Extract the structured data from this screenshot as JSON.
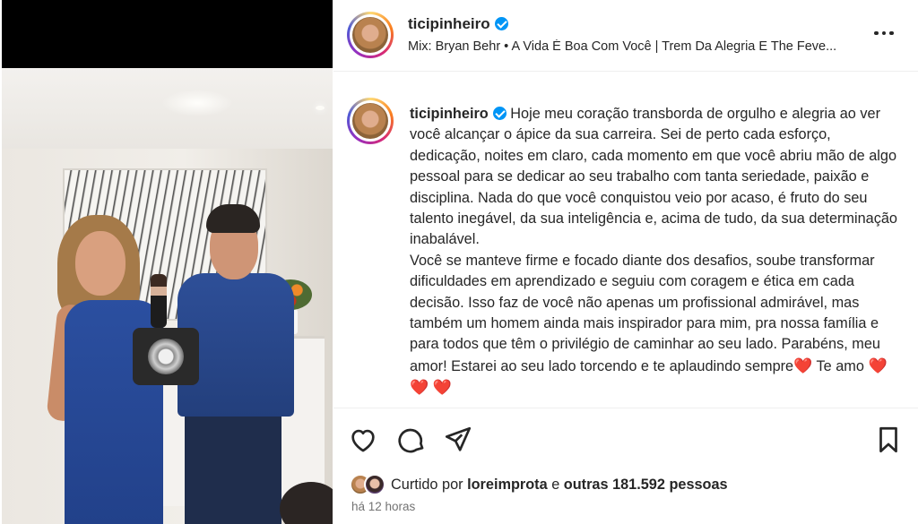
{
  "post": {
    "username": "ticipinheiro",
    "audio": "Mix: Bryan Behr • A Vida É Boa Com Você | Trem Da Alegria E The Feve...",
    "caption_text": "Hoje meu coração transborda de orgulho e alegria ao ver você alcançar o ápice da sua carreira. Sei de perto cada esforço, dedicação, noites em claro, cada momento em que você abriu mão de algo pessoal para se dedicar ao seu trabalho com tanta seriedade, paixão e disciplina. Nada do que você conquistou veio por acaso, é fruto do seu talento inegável, da sua inteligência e, acima de tudo, da sua determinação inabalável.\nVocê se manteve firme e focado diante dos desafios, soube transformar dificuldades em aprendizado e seguiu com coragem e ética em cada decisão. Isso faz de você não apenas um profissional admirável, mas também um homem ainda mais inspirador para mim, pra nossa família e para todos que têm o privilégio de caminhar ao seu lado. Parabéns, meu amor! Estarei ao seu lado torcendo e te aplaudindo sempre",
    "caption_heart": "❤️",
    "caption_end": " Te amo ",
    "caption_hearts": "❤️ ❤️ ❤️",
    "likes_prefix": "Curtido por",
    "liked_by_user": "loreimprota",
    "likes_join": "e",
    "likes_others": "outras 181.592 pessoas",
    "time_ago": "há 12 horas"
  },
  "icons": {
    "more": "more-options-icon",
    "like": "heart-icon",
    "comment": "comment-icon",
    "share": "share-icon",
    "save": "bookmark-icon"
  },
  "colors": {
    "verified": "#0095f6",
    "text": "#262626",
    "secondary": "#737373"
  }
}
